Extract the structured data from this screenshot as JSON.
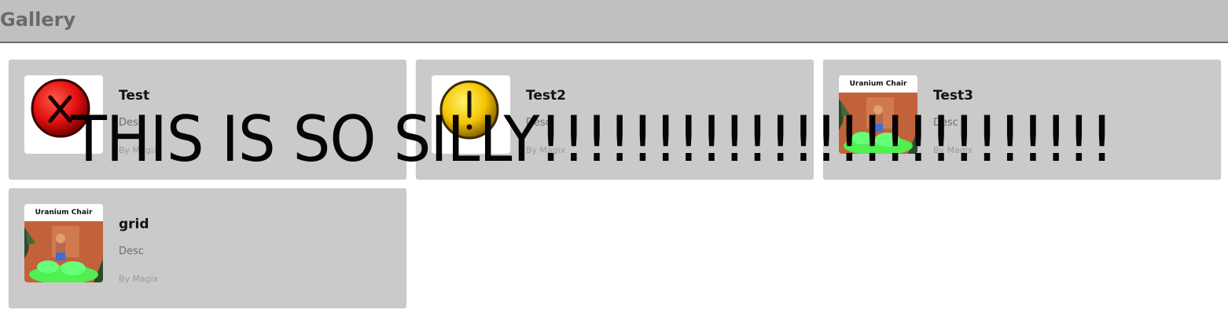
{
  "header": {
    "title": "Gallery"
  },
  "items": [
    {
      "name": "Test",
      "desc": "Desc",
      "author": "By Magix",
      "icon": "error-x-icon"
    },
    {
      "name": "Test2",
      "desc": "Desc",
      "author": "By Magix",
      "icon": "warning-exclamation-icon"
    },
    {
      "name": "Test3",
      "desc": "Desc",
      "author": "By Magix",
      "icon": "uranium-chair-thumbnail",
      "thumb_caption": "Uranium Chair"
    },
    {
      "name": "grid",
      "desc": "Desc",
      "author": "By Magix",
      "icon": "uranium-chair-thumbnail",
      "thumb_caption": "Uranium Chair"
    }
  ],
  "overlay": {
    "text": "THIS IS SO SILLY!!!!!!!!!!!!!!!!!!!!!!!!!"
  },
  "colors": {
    "topbar_bg": "#c0c0c0",
    "card_bg": "#cacaca",
    "error_red": "#e01010",
    "warning_yellow": "#f5c400",
    "slime_green": "#44ff55"
  }
}
